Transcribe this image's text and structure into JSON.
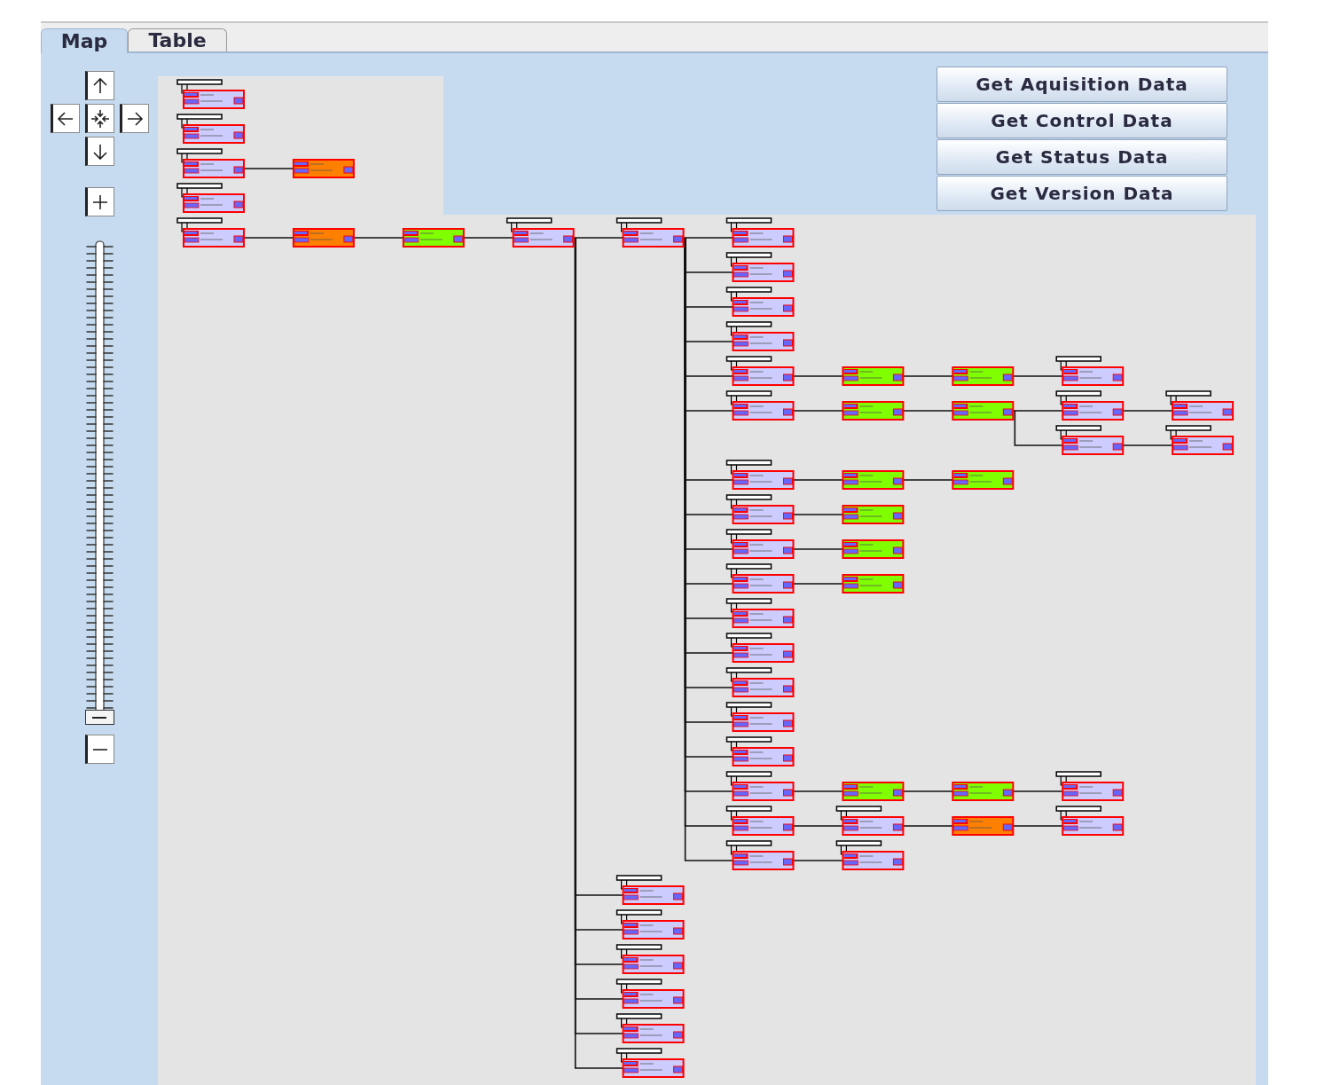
{
  "tabs": [
    {
      "label": "Map",
      "selected": true
    },
    {
      "label": "Table",
      "selected": false
    }
  ],
  "zoom": {
    "level": 0
  },
  "buttons": [
    "Get Aquisition Data",
    "Get Control Data",
    "Get Status Data",
    "Get Version Data"
  ],
  "map": {
    "nodes": [
      {
        "kind": "device",
        "color": "#ccccff"
      },
      {
        "kind": "device",
        "color": "#ccccff"
      },
      {
        "kind": "device",
        "color": "#ccccff",
        "children": [
          {
            "kind": "module",
            "color": "#ff8000"
          }
        ]
      },
      {
        "kind": "device",
        "color": "#ccccff"
      },
      {
        "kind": "device",
        "color": "#ccccff",
        "children": [
          {
            "kind": "module",
            "color": "#ff8000",
            "children": [
              {
                "kind": "module",
                "color": "#80ff00",
                "children": [
                  {
                    "kind": "device",
                    "color": "#ccccff",
                    "children": [
                      {
                        "kind": "device",
                        "color": "#ccccff",
                        "children": [
                          {
                            "kind": "device",
                            "color": "#ccccff"
                          },
                          {
                            "kind": "device",
                            "color": "#ccccff"
                          },
                          {
                            "kind": "device",
                            "color": "#ccccff"
                          },
                          {
                            "kind": "device",
                            "color": "#ccccff"
                          },
                          {
                            "kind": "device",
                            "color": "#ccccff",
                            "children": [
                              {
                                "kind": "module",
                                "color": "#80ff00",
                                "children": [
                                  {
                                    "kind": "module",
                                    "color": "#80ff00",
                                    "children": [
                                      {
                                        "kind": "device",
                                        "color": "#ccccff"
                                      }
                                    ]
                                  }
                                ]
                              }
                            ]
                          },
                          {
                            "kind": "device",
                            "color": "#ccccff",
                            "children": [
                              {
                                "kind": "module",
                                "color": "#80ff00",
                                "children": [
                                  {
                                    "kind": "module",
                                    "color": "#80ff00",
                                    "children": [
                                      {
                                        "kind": "device",
                                        "color": "#ccccff",
                                        "children": [
                                          {
                                            "kind": "device",
                                            "color": "#ccccff"
                                          }
                                        ]
                                      },
                                      {
                                        "kind": "device",
                                        "color": "#ccccff",
                                        "children": [
                                          {
                                            "kind": "device",
                                            "color": "#ccccff"
                                          }
                                        ]
                                      }
                                    ]
                                  }
                                ]
                              }
                            ]
                          },
                          {
                            "kind": "device",
                            "color": "#ccccff",
                            "children": [
                              {
                                "kind": "module",
                                "color": "#80ff00",
                                "children": [
                                  {
                                    "kind": "module",
                                    "color": "#80ff00"
                                  }
                                ]
                              }
                            ]
                          },
                          {
                            "kind": "device",
                            "color": "#ccccff",
                            "children": [
                              {
                                "kind": "module",
                                "color": "#80ff00"
                              }
                            ]
                          },
                          {
                            "kind": "device",
                            "color": "#ccccff",
                            "children": [
                              {
                                "kind": "module",
                                "color": "#80ff00"
                              }
                            ]
                          },
                          {
                            "kind": "device",
                            "color": "#ccccff",
                            "children": [
                              {
                                "kind": "module",
                                "color": "#80ff00"
                              }
                            ]
                          },
                          {
                            "kind": "device",
                            "color": "#ccccff"
                          },
                          {
                            "kind": "device",
                            "color": "#ccccff"
                          },
                          {
                            "kind": "device",
                            "color": "#ccccff"
                          },
                          {
                            "kind": "device",
                            "color": "#ccccff"
                          },
                          {
                            "kind": "device",
                            "color": "#ccccff"
                          },
                          {
                            "kind": "device",
                            "color": "#ccccff",
                            "children": [
                              {
                                "kind": "module",
                                "color": "#80ff00",
                                "children": [
                                  {
                                    "kind": "module",
                                    "color": "#80ff00",
                                    "children": [
                                      {
                                        "kind": "device",
                                        "color": "#ccccff"
                                      }
                                    ]
                                  }
                                ]
                              }
                            ]
                          },
                          {
                            "kind": "device",
                            "color": "#ccccff",
                            "children": [
                              {
                                "kind": "device",
                                "color": "#ccccff",
                                "children": [
                                  {
                                    "kind": "module",
                                    "color": "#ff8000",
                                    "children": [
                                      {
                                        "kind": "device",
                                        "color": "#ccccff"
                                      }
                                    ]
                                  }
                                ]
                              }
                            ]
                          },
                          {
                            "kind": "device",
                            "color": "#ccccff",
                            "children": [
                              {
                                "kind": "device",
                                "color": "#ccccff"
                              }
                            ]
                          }
                        ]
                      },
                      {
                        "kind": "device",
                        "color": "#ccccff"
                      },
                      {
                        "kind": "device",
                        "color": "#ccccff"
                      },
                      {
                        "kind": "device",
                        "color": "#ccccff"
                      },
                      {
                        "kind": "device",
                        "color": "#ccccff"
                      },
                      {
                        "kind": "device",
                        "color": "#ccccff"
                      },
                      {
                        "kind": "device",
                        "color": "#ccccff"
                      }
                    ]
                  }
                ]
              }
            ]
          }
        ]
      }
    ]
  }
}
